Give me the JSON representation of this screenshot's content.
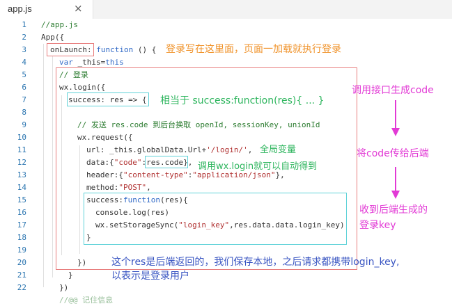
{
  "tab": {
    "title": "app.js",
    "close_label": "×"
  },
  "lines": [
    "1",
    "2",
    "3",
    "4",
    "5",
    "6",
    "7",
    "8",
    "9",
    "10",
    "11",
    "12",
    "13",
    "14",
    "15",
    "16",
    "17",
    "18",
    "19",
    "20",
    "21",
    "22"
  ],
  "code": {
    "l1": "//app.js",
    "l2": "App({",
    "l3_a": "onLaunch:",
    "l3_b": " function",
    "l3_c": " () {",
    "l4_a": "var",
    "l4_b": " _this=",
    "l4_c": "this",
    "l5": "// 登录",
    "l6": "wx.login({",
    "l7_a": "success: res => {",
    "l9": "// 发送 res.code 到后台换取 openId, sessionKey, unionId",
    "l10": "wx.request({",
    "l11_a": "url: _this.globalData.Url+",
    "l11_b": "'/login/'",
    "l11_c": ",",
    "l12_a": "data:{",
    "l12_b": "\"code\"",
    "l12_c": ":",
    "l12_d": "res.code",
    "l12_e": "},",
    "l13_a": "header:{",
    "l13_b": "\"content-type\"",
    "l13_c": ":",
    "l13_d": "\"application/json\"",
    "l13_e": "},",
    "l14_a": "method:",
    "l14_b": "\"POST\"",
    "l14_c": ",",
    "l15_a": "success:",
    "l15_b": "function",
    "l15_c": "(res){",
    "l16": "console.log(res)",
    "l17_a": "wx.setStorageSync(",
    "l17_b": "\"login_key\"",
    "l17_c": ",res.data.data.login_key)",
    "l18": "}",
    "l20": "})",
    "l21": "}",
    "l22": "})",
    "l23": "//@@ 记住信息"
  },
  "annotations": {
    "onlaunch_note": "登录写在这里面，页面一加载就执行登录",
    "success_note": "相当于 success:function(res){ ... }",
    "global_var_note": "全局变量",
    "auto_get_note": "调用wx.login就可以自动得到",
    "response_note_1": "这个res是后端返回的，我们保存本地，之后请求都携带login_key,",
    "response_note_2": "以表示是登录用户",
    "side_1": "调用接口生成code",
    "side_2": "将code传给后端",
    "side_3a": "收到后端生成的",
    "side_3b": "登录key"
  },
  "colors": {
    "annotation_orange": "#f0932b",
    "annotation_green": "#2db55d",
    "annotation_blue": "#3955c2",
    "arrow_magenta": "#e23ad5",
    "box_red": "#e87d7d",
    "box_cyan": "#5fd2d8"
  }
}
